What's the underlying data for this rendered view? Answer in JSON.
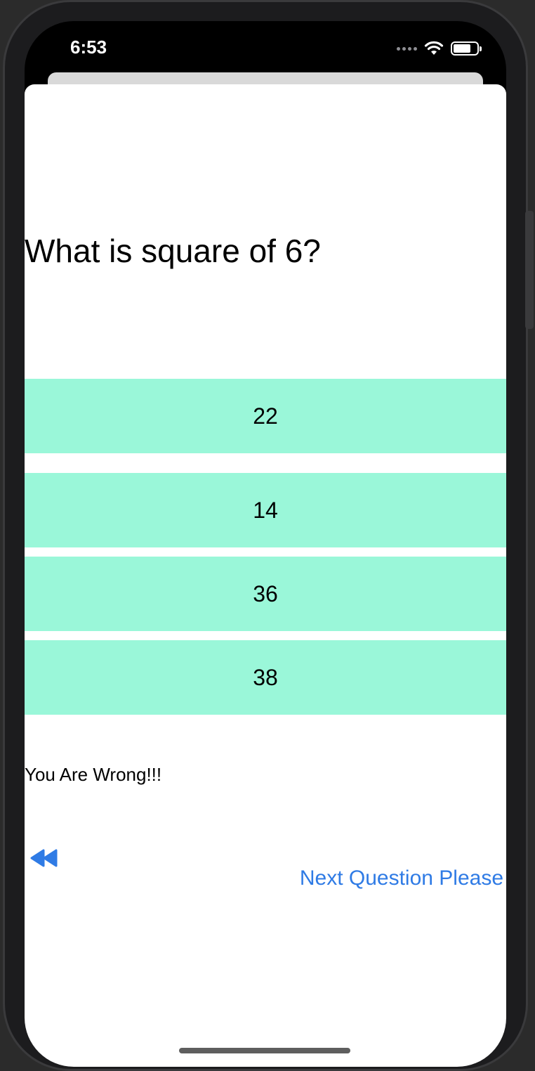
{
  "status_bar": {
    "time": "6:53",
    "icons": [
      "signal-dots-icon",
      "wifi-icon",
      "battery-icon"
    ],
    "battery_level": 0.75
  },
  "quiz": {
    "question": "What is square of 6?",
    "options": [
      "22",
      "14",
      "36",
      "38"
    ],
    "feedback": "You Are Wrong!!!",
    "back_icon": "rewind-icon",
    "next_label": "Next Question Please"
  },
  "colors": {
    "option_background": "#9af7d9",
    "link_blue": "#2f7be5"
  }
}
